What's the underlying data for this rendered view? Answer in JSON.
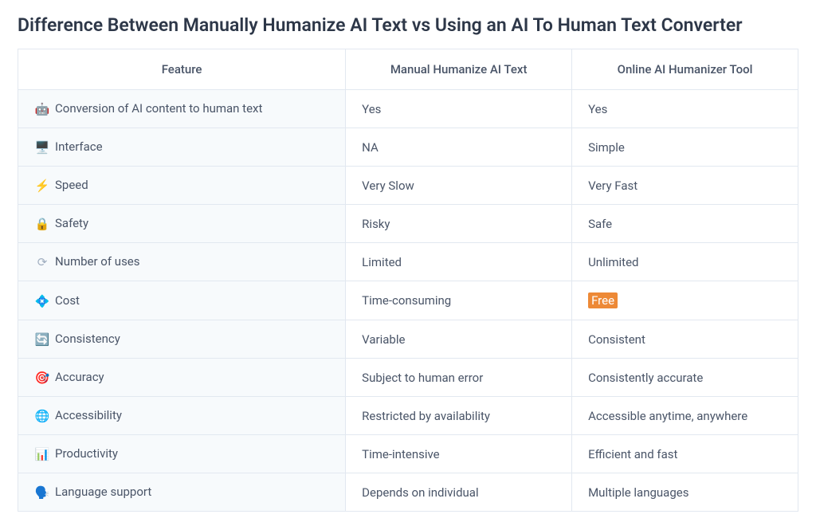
{
  "title": "Difference Between Manually Humanize AI Text vs Using an AI To Human Text Converter",
  "columns": {
    "feature": "Feature",
    "manual": "Manual Humanize AI Text",
    "tool": "Online AI Humanizer Tool"
  },
  "rows": [
    {
      "icon_name": "robot-icon",
      "icon_glyph": "🤖",
      "icon_class": "",
      "feature": "Conversion of AI content to human text",
      "manual": "Yes",
      "tool": "Yes",
      "tool_highlight": false
    },
    {
      "icon_name": "monitor-icon",
      "icon_glyph": "🖥️",
      "icon_class": "",
      "feature": "Interface",
      "manual": "NA",
      "tool": "Simple",
      "tool_highlight": false
    },
    {
      "icon_name": "bolt-icon",
      "icon_glyph": "⚡",
      "icon_class": "ic-speed",
      "feature": "Speed",
      "manual": "Very Slow",
      "tool": "Very Fast",
      "tool_highlight": false
    },
    {
      "icon_name": "lock-icon",
      "icon_glyph": "🔒",
      "icon_class": "ic-safety",
      "feature": "Safety",
      "manual": "Risky",
      "tool": "Safe",
      "tool_highlight": false
    },
    {
      "icon_name": "refresh-icon",
      "icon_glyph": "⟳",
      "icon_class": "ic-uses",
      "feature": "Number of uses",
      "manual": "Limited",
      "tool": "Unlimited",
      "tool_highlight": false
    },
    {
      "icon_name": "diamond-icon",
      "icon_glyph": "💠",
      "icon_class": "ic-cost",
      "feature": "Cost",
      "manual": "Time-consuming",
      "tool": "Free",
      "tool_highlight": true
    },
    {
      "icon_name": "sync-icon",
      "icon_glyph": "🔄",
      "icon_class": "ic-cons",
      "feature": "Consistency",
      "manual": "Variable",
      "tool": "Consistent",
      "tool_highlight": false
    },
    {
      "icon_name": "target-icon",
      "icon_glyph": "🎯",
      "icon_class": "ic-acc",
      "feature": "Accuracy",
      "manual": "Subject to human error",
      "tool": "Consistently accurate",
      "tool_highlight": false
    },
    {
      "icon_name": "globe-icon",
      "icon_glyph": "🌐",
      "icon_class": "ic-access",
      "feature": "Accessibility",
      "manual": "Restricted by availability",
      "tool": "Accessible anytime, anywhere",
      "tool_highlight": false
    },
    {
      "icon_name": "chart-icon",
      "icon_glyph": "📊",
      "icon_class": "",
      "feature": "Productivity",
      "manual": "Time-intensive",
      "tool": "Efficient and fast",
      "tool_highlight": false
    },
    {
      "icon_name": "speech-icon",
      "icon_glyph": "🗣️",
      "icon_class": "ic-lang",
      "feature": "Language support",
      "manual": "Depends on individual",
      "tool": "Multiple languages",
      "tool_highlight": false
    }
  ]
}
